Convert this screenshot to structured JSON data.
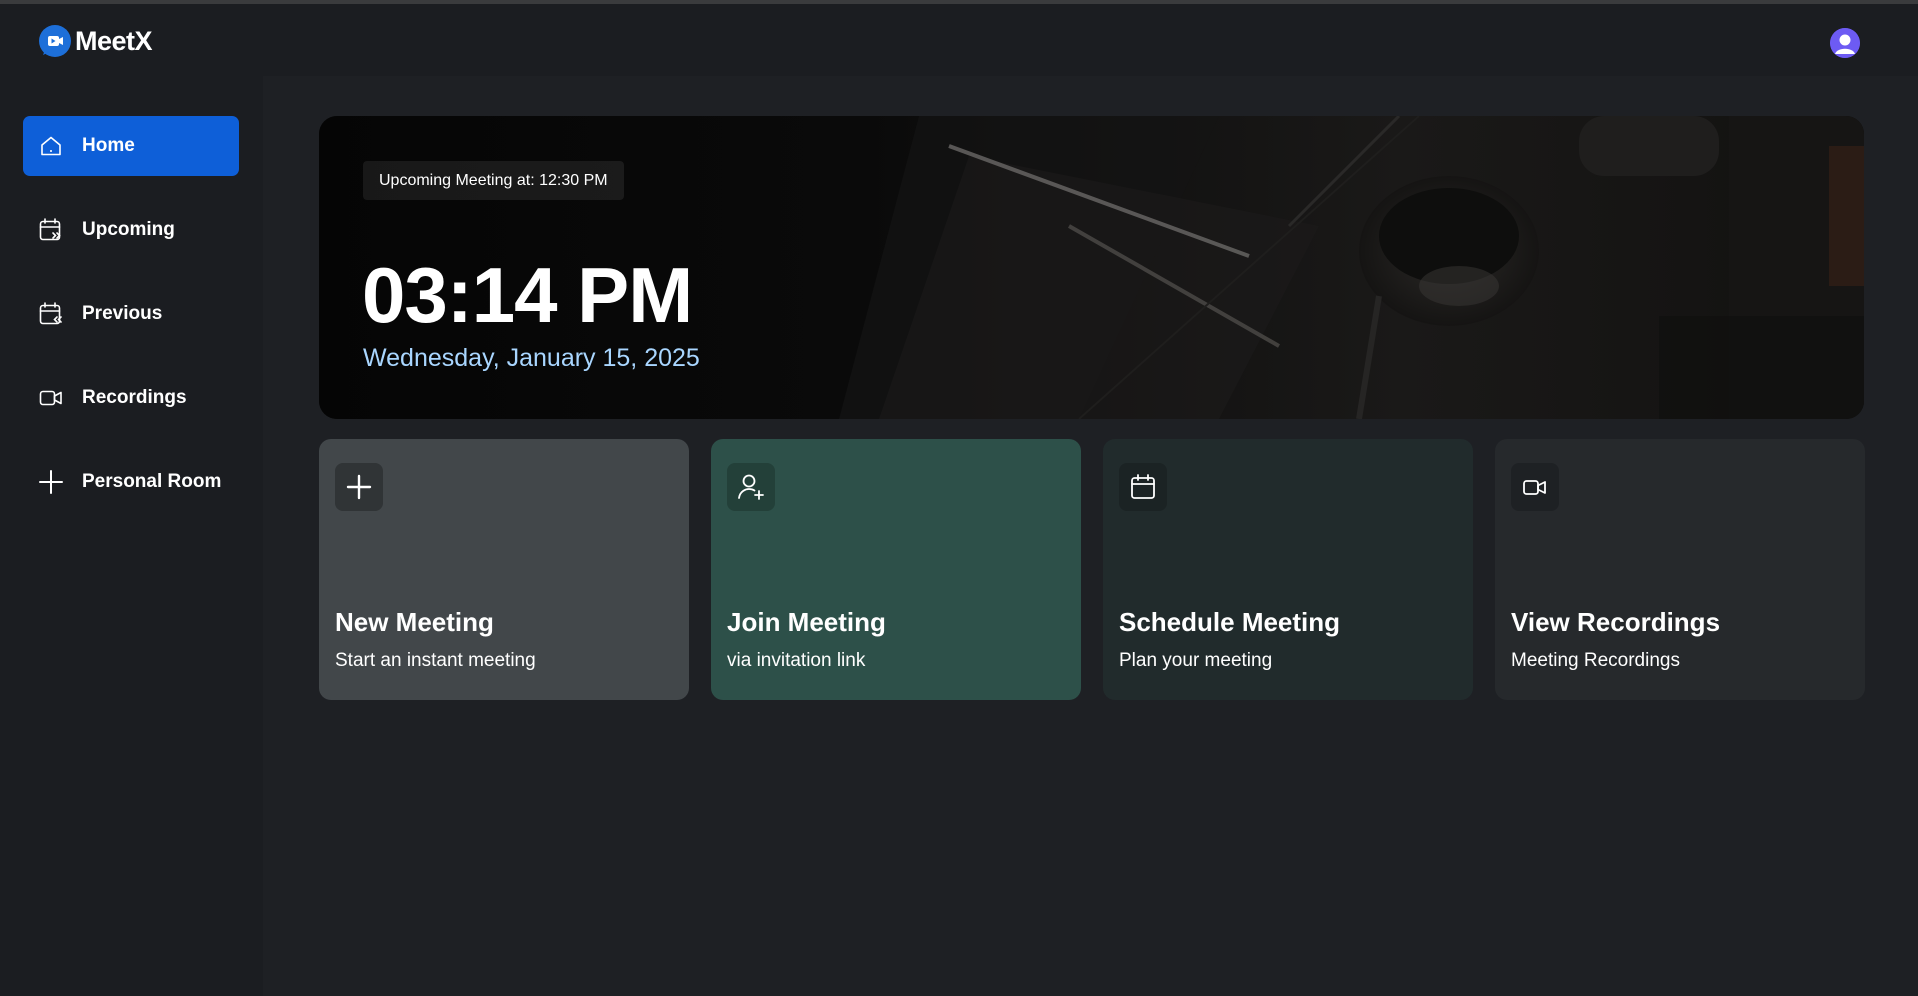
{
  "app": {
    "name": "MeetX"
  },
  "sidebar": {
    "items": [
      {
        "label": "Home",
        "icon": "home-icon",
        "active": true
      },
      {
        "label": "Upcoming",
        "icon": "calendar-forward-icon",
        "active": false
      },
      {
        "label": "Previous",
        "icon": "calendar-back-icon",
        "active": false
      },
      {
        "label": "Recordings",
        "icon": "video-icon",
        "active": false
      },
      {
        "label": "Personal Room",
        "icon": "plus-icon",
        "active": false
      }
    ]
  },
  "hero": {
    "upcoming": "Upcoming Meeting at: 12:30 PM",
    "time": "03:14 PM",
    "date": "Wednesday, January 15, 2025"
  },
  "cards": [
    {
      "title": "New Meeting",
      "subtitle": "Start an instant meeting",
      "icon": "plus-icon",
      "color": "#42474a"
    },
    {
      "title": "Join Meeting",
      "subtitle": "via invitation link",
      "icon": "user-plus-icon",
      "color": "#2d5049"
    },
    {
      "title": "Schedule Meeting",
      "subtitle": "Plan your meeting",
      "icon": "calendar-icon",
      "color": "#212b2c"
    },
    {
      "title": "View Recordings",
      "subtitle": "Meeting Recordings",
      "icon": "video-icon",
      "color": "#26292c"
    }
  ],
  "colors": {
    "accent": "#0e5fd8",
    "date_text": "#a9d6ff",
    "avatar": "#6d5bf3"
  }
}
